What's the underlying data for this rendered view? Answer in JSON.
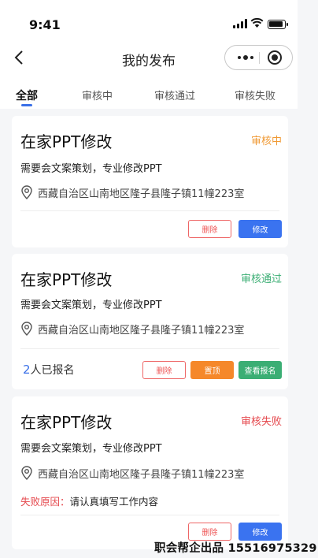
{
  "status_bar": {
    "time": "9:41"
  },
  "nav": {
    "title": "我的发布"
  },
  "tabs": [
    {
      "label": "全部"
    },
    {
      "label": "审核中"
    },
    {
      "label": "审核通过"
    },
    {
      "label": "审核失败"
    }
  ],
  "colors": {
    "accent": "#3a70e8",
    "pending": "#f09a35",
    "approved": "#3bae74",
    "failed": "#e5484d"
  },
  "cards": [
    {
      "title": "在家PPT修改",
      "status": "审核中",
      "description": "需要会文案策划，专业修改PPT",
      "location": "西藏自治区山南地区隆子县隆子镇11幢223室",
      "buttons": [
        "删除",
        "修改"
      ]
    },
    {
      "title": "在家PPT修改",
      "status": "审核通过",
      "description": "需要会文案策划，专业修改PPT",
      "location": "西藏自治区山南地区隆子县隆子镇11幢223室",
      "signup_count": "2",
      "signup_text": "人已报名",
      "buttons": [
        "删除",
        "置顶",
        "查看报名"
      ]
    },
    {
      "title": "在家PPT修改",
      "status": "审核失败",
      "description": "需要会文案策划，专业修改PPT",
      "location": "西藏自治区山南地区隆子县隆子镇11幢223室",
      "reason_label": "失败原因：",
      "reason_text": "请认真填写工作内容",
      "buttons": [
        "删除",
        "修改"
      ]
    }
  ],
  "watermark": "职会帮企出品 15516975329"
}
